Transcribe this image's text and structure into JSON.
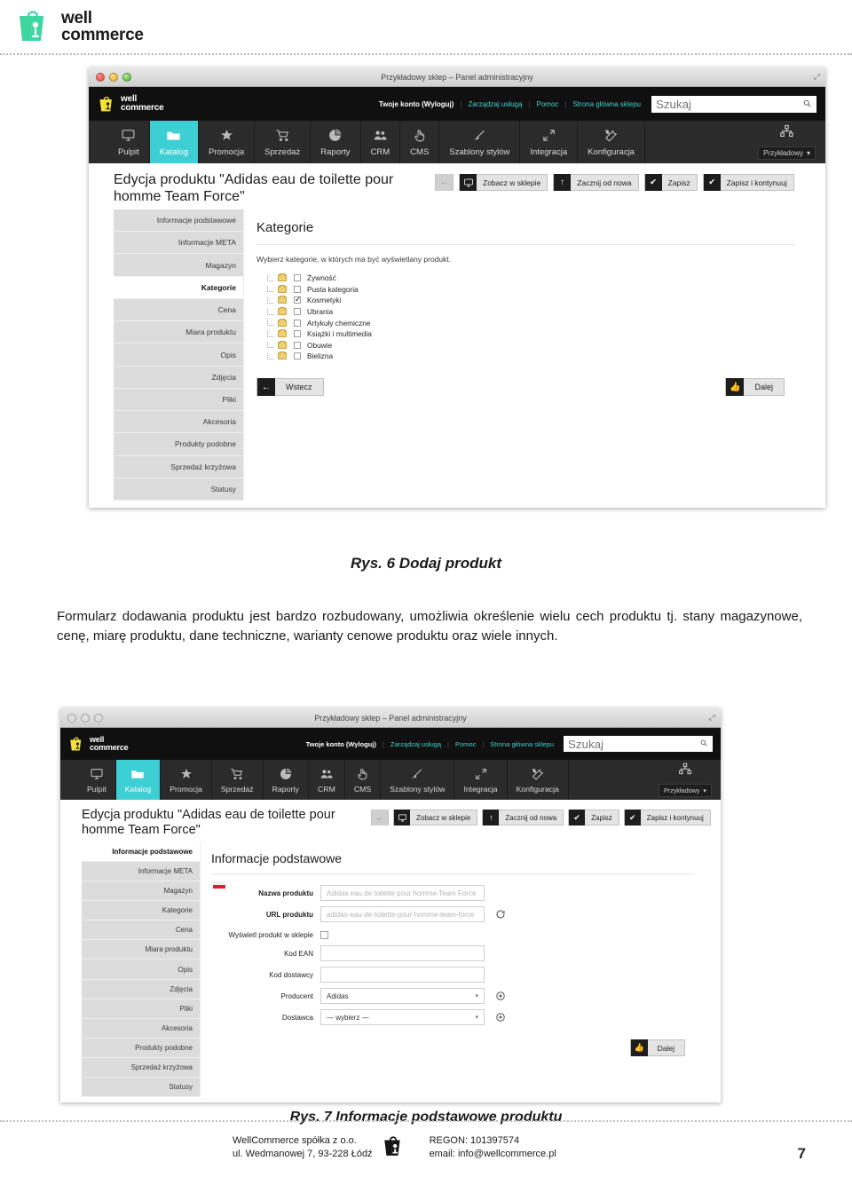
{
  "brand": {
    "line1": "well",
    "line2": "commerce",
    "logo_icon": "wellcommerce-bag-logo"
  },
  "figures": [
    {
      "id": "fig6",
      "window_title": "Przykładowy sklep – Panel administracyjny",
      "admin_header": {
        "logo_line1": "well",
        "logo_line2": "commerce",
        "links": [
          {
            "label": "Twoje konto (Wyloguj)",
            "kind": "account"
          },
          {
            "label": "Zarządzaj usługą",
            "kind": "link"
          },
          {
            "label": "Pomoc",
            "kind": "link"
          },
          {
            "label": "Strona główna sklepu",
            "kind": "link"
          }
        ],
        "search_placeholder": "Szukaj",
        "search_value": "",
        "search_icon": "search-icon"
      },
      "nav": {
        "items": [
          {
            "label": "Pulpit",
            "icon": "monitor-icon",
            "active": false
          },
          {
            "label": "Katalog",
            "icon": "folder-icon",
            "active": true
          },
          {
            "label": "Promocja",
            "icon": "star-icon",
            "active": false
          },
          {
            "label": "Sprzedaż",
            "icon": "cart-icon",
            "active": false
          },
          {
            "label": "Raporty",
            "icon": "pie-chart-icon",
            "active": false
          },
          {
            "label": "CRM",
            "icon": "users-icon",
            "active": false
          },
          {
            "label": "CMS",
            "icon": "hand-pointer-icon",
            "active": false
          },
          {
            "label": "Szablony stylów",
            "icon": "brush-icon",
            "active": false
          },
          {
            "label": "Integracja",
            "icon": "arrows-in-icon",
            "active": false
          },
          {
            "label": "Konfiguracja",
            "icon": "tools-icon",
            "active": false
          }
        ],
        "shop_selector": {
          "label": "Przykładowy",
          "icon": "sitemap-icon",
          "caret": "▾"
        }
      },
      "page_title": "Edycja produktu \"Adidas eau de toilette pour homme Team Force\"",
      "action_buttons": [
        {
          "label": "",
          "icon": "arrow-left-icon",
          "ghost": true
        },
        {
          "label": "Zobacz w sklepie",
          "icon": "monitor-icon",
          "ghost": false
        },
        {
          "label": "Zacznij od nowa",
          "icon": "arrow-up-icon",
          "ghost": false
        },
        {
          "label": "Zapisz",
          "icon": "check-icon",
          "ghost": false
        },
        {
          "label": "Zapisz i kontynuuj",
          "icon": "check-double-icon",
          "ghost": false
        }
      ],
      "sidebar": [
        {
          "label": "Informacje podstawowe",
          "active": false
        },
        {
          "label": "Informacje META",
          "active": false
        },
        {
          "label": "Magazyn",
          "active": false
        },
        {
          "label": "Kategorie",
          "active": true
        },
        {
          "label": "Cena",
          "active": false
        },
        {
          "label": "Miara produktu",
          "active": false
        },
        {
          "label": "Opis",
          "active": false
        },
        {
          "label": "Zdjęcia",
          "active": false
        },
        {
          "label": "Pliki",
          "active": false
        },
        {
          "label": "Akcesoria",
          "active": false
        },
        {
          "label": "Produkty podobne",
          "active": false
        },
        {
          "label": "Sprzedaż krzyżowa",
          "active": false
        },
        {
          "label": "Statusy",
          "active": false
        }
      ],
      "panel": {
        "heading": "Kategorie",
        "hint": "Wybierz kategorie, w których ma być wyświetlany produkt.",
        "categories": [
          {
            "label": "Żywność",
            "checked": false
          },
          {
            "label": "Pusta kategoria",
            "checked": false
          },
          {
            "label": "Kosmetyki",
            "checked": true
          },
          {
            "label": "Ubrania",
            "checked": false
          },
          {
            "label": "Artykuły chemiczne",
            "checked": false
          },
          {
            "label": "Książki i multimedia",
            "checked": false
          },
          {
            "label": "Obuwie",
            "checked": false
          },
          {
            "label": "Bielizna",
            "checked": false
          }
        ],
        "back_button": {
          "label": "Wstecz",
          "icon": "arrow-left-icon"
        },
        "next_button": {
          "label": "Dalej",
          "icon": "thumbs-up-icon"
        }
      },
      "caption": "Rys. 6 Dodaj produkt"
    },
    {
      "id": "fig7",
      "window_title": "Przykładowy sklep – Panel administracyjny",
      "admin_header": {
        "logo_line1": "well",
        "logo_line2": "commerce",
        "links": [
          {
            "label": "Twoje konto (Wyloguj)",
            "kind": "account"
          },
          {
            "label": "Zarządzaj usługą",
            "kind": "link"
          },
          {
            "label": "Pomoc",
            "kind": "link"
          },
          {
            "label": "Strona główna sklepu",
            "kind": "link"
          }
        ],
        "search_placeholder": "Szukaj",
        "search_value": "",
        "search_icon": "search-icon"
      },
      "nav": {
        "items": [
          {
            "label": "Pulpit",
            "icon": "monitor-icon",
            "active": false
          },
          {
            "label": "Katalog",
            "icon": "folder-icon",
            "active": true
          },
          {
            "label": "Promocja",
            "icon": "star-icon",
            "active": false
          },
          {
            "label": "Sprzedaż",
            "icon": "cart-icon",
            "active": false
          },
          {
            "label": "Raporty",
            "icon": "pie-chart-icon",
            "active": false
          },
          {
            "label": "CRM",
            "icon": "users-icon",
            "active": false
          },
          {
            "label": "CMS",
            "icon": "hand-pointer-icon",
            "active": false
          },
          {
            "label": "Szablony stylów",
            "icon": "brush-icon",
            "active": false
          },
          {
            "label": "Integracja",
            "icon": "arrows-in-icon",
            "active": false
          },
          {
            "label": "Konfiguracja",
            "icon": "tools-icon",
            "active": false
          }
        ],
        "shop_selector": {
          "label": "Przykładowy",
          "icon": "sitemap-icon",
          "caret": "▾"
        }
      },
      "page_title": "Edycja produktu \"Adidas eau de toilette pour homme Team Force\"",
      "action_buttons": [
        {
          "label": "",
          "icon": "arrow-left-icon",
          "ghost": true
        },
        {
          "label": "Zobacz w sklepie",
          "icon": "monitor-icon",
          "ghost": false
        },
        {
          "label": "Zacznij od nowa",
          "icon": "arrow-up-icon",
          "ghost": false
        },
        {
          "label": "Zapisz",
          "icon": "check-icon",
          "ghost": false
        },
        {
          "label": "Zapisz i kontynuuj",
          "icon": "check-double-icon",
          "ghost": false
        }
      ],
      "sidebar": [
        {
          "label": "Informacje podstawowe",
          "active": true
        },
        {
          "label": "Informacje META",
          "active": false
        },
        {
          "label": "Magazyn",
          "active": false
        },
        {
          "label": "Kategorie",
          "active": false
        },
        {
          "label": "Cena",
          "active": false
        },
        {
          "label": "Miara produktu",
          "active": false
        },
        {
          "label": "Opis",
          "active": false
        },
        {
          "label": "Zdjęcia",
          "active": false
        },
        {
          "label": "Pliki",
          "active": false
        },
        {
          "label": "Akcesoria",
          "active": false
        },
        {
          "label": "Produkty podobne",
          "active": false
        },
        {
          "label": "Sprzedaż krzyżowa",
          "active": false
        },
        {
          "label": "Statusy",
          "active": false
        }
      ],
      "panel": {
        "heading": "Informacje podstawowe",
        "language_flag": "pl-flag-icon",
        "fields": [
          {
            "label": "Nazwa produktu",
            "type": "text",
            "value": "",
            "placeholder": "Adidas eau de toilette pour homme Team Force",
            "bold": true
          },
          {
            "label": "URL produktu",
            "type": "text",
            "value": "",
            "placeholder": "adidas-eau-de-toilette-pour-homme-team-force",
            "bold": true,
            "addon": "refresh-icon"
          },
          {
            "label": "Wyświetl produkt w sklepie",
            "type": "checkbox",
            "checked": false,
            "bold": false
          },
          {
            "label": "Kod EAN",
            "type": "text",
            "value": "",
            "placeholder": "",
            "bold": false
          },
          {
            "label": "Kod dostawcy",
            "type": "text",
            "value": "",
            "placeholder": "",
            "bold": false
          },
          {
            "label": "Producent",
            "type": "select",
            "value": "Adidas",
            "bold": false,
            "addon": "plus-circle-icon"
          },
          {
            "label": "Dostawca",
            "type": "select",
            "value": "— wybierz —",
            "bold": false,
            "addon": "plus-circle-icon"
          }
        ],
        "next_button": {
          "label": "Dalej",
          "icon": "thumbs-up-icon"
        }
      },
      "caption": "Rys. 7 Informacje podstawowe produktu"
    }
  ],
  "prose": "Formularz dodawania produktu jest bardzo rozbudowany, umożliwia określenie wielu cech produktu tj. stany magazynowe, cenę, miarę produktu, dane techniczne, warianty cenowe produktu oraz wiele innych.",
  "footer": {
    "company": "WellCommerce spółka z o.o.",
    "address": "ul. Wedmanowej 7, 93-228 Łódź",
    "logo_icon": "wellcommerce-bag-logo",
    "regon": "REGON: 101397574",
    "email": "email: info@wellcommerce.pl",
    "page_number": "7"
  }
}
